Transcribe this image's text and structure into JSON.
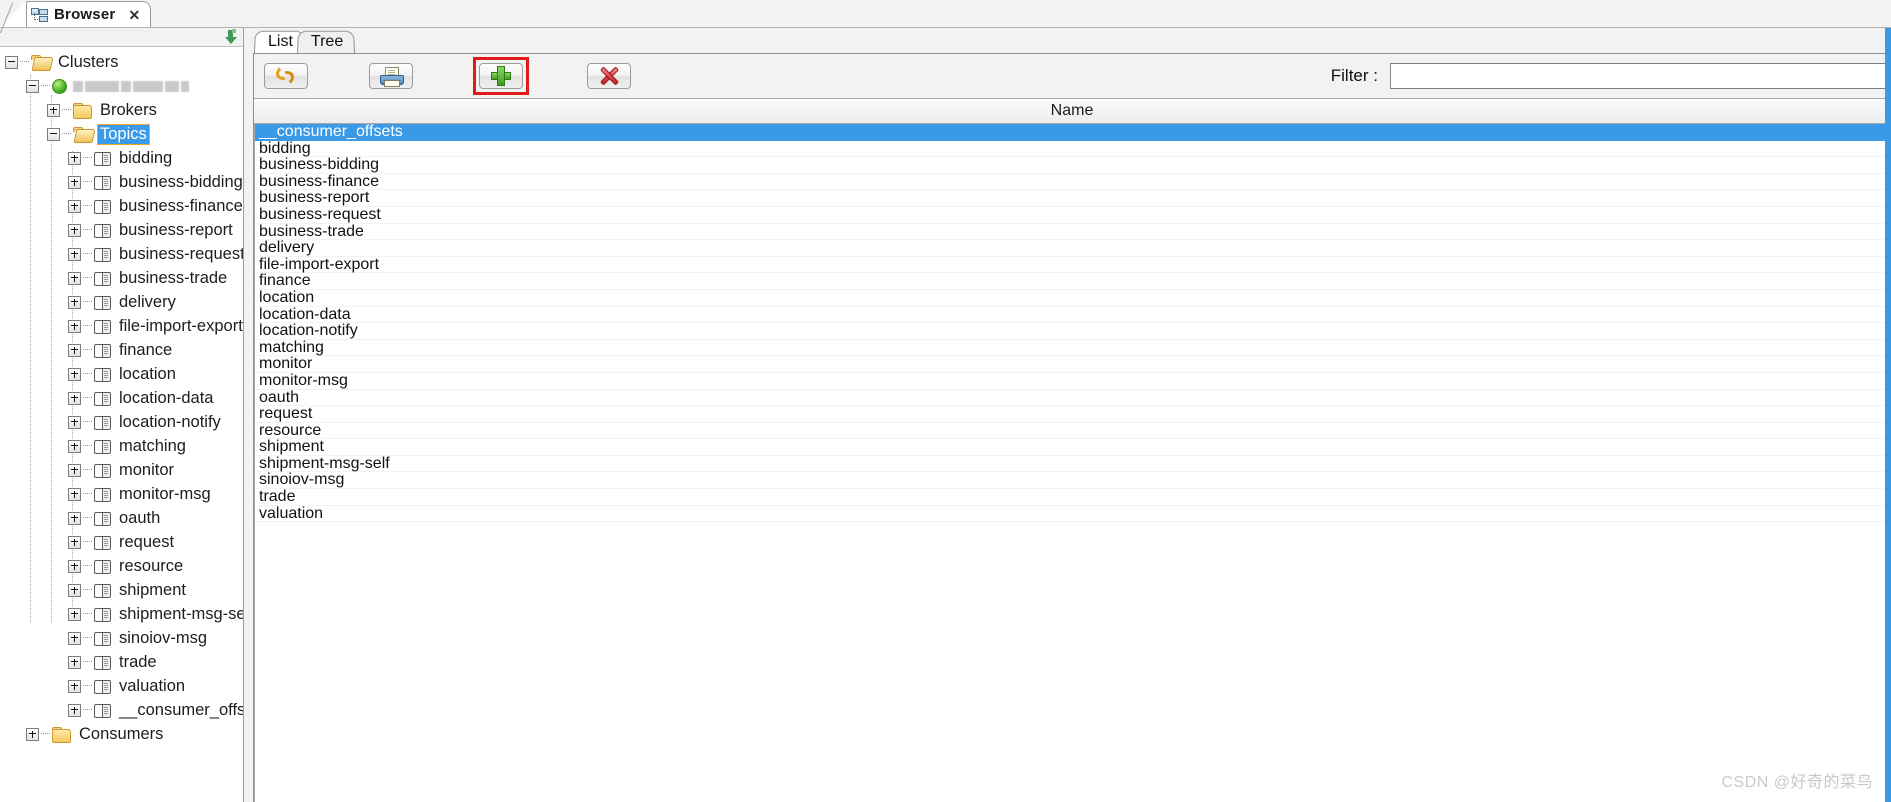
{
  "window": {
    "tab_title": "Browser",
    "tab_close": "✕",
    "browser_icon": "browser-tree-icon"
  },
  "tree_panel": {
    "collapse_all_icon": "collapse-all-down-arrow-icon",
    "root": {
      "label": "Clusters",
      "cluster": {
        "label_redacted": true,
        "status": "online"
      },
      "children": [
        {
          "label": "Brokers",
          "type": "folder",
          "state": "collapsed"
        },
        {
          "label": "Topics",
          "type": "folder",
          "state": "expanded",
          "selected": true
        },
        {
          "label": "Consumers",
          "type": "folder",
          "state": "collapsed"
        }
      ]
    },
    "topics": [
      "bidding",
      "business-bidding",
      "business-finance",
      "business-report",
      "business-request",
      "business-trade",
      "delivery",
      "file-import-export",
      "finance",
      "location",
      "location-data",
      "location-notify",
      "matching",
      "monitor",
      "monitor-msg",
      "oauth",
      "request",
      "resource",
      "shipment",
      "shipment-msg-self",
      "sinoiov-msg",
      "trade",
      "valuation",
      "__consumer_offsets"
    ]
  },
  "content": {
    "tabs": [
      {
        "label": "List",
        "active": true
      },
      {
        "label": "Tree",
        "active": false
      }
    ],
    "toolbar": {
      "buttons": [
        {
          "name": "refresh-button",
          "icon": "refresh-icon",
          "highlighted": false
        },
        {
          "name": "export-button",
          "icon": "printer-icon",
          "highlighted": false
        },
        {
          "name": "add-button",
          "icon": "plus-icon",
          "highlighted": true
        },
        {
          "name": "delete-button",
          "icon": "red-x-icon",
          "highlighted": false
        }
      ],
      "filter_label": "Filter :",
      "filter_value": "",
      "filter_placeholder": ""
    },
    "table": {
      "columns": [
        "Name"
      ],
      "selected_row_index": 0,
      "rows": [
        "__consumer_offsets",
        "bidding",
        "business-bidding",
        "business-finance",
        "business-report",
        "business-request",
        "business-trade",
        "delivery",
        "file-import-export",
        "finance",
        "location",
        "location-data",
        "location-notify",
        "matching",
        "monitor",
        "monitor-msg",
        "oauth",
        "request",
        "resource",
        "shipment",
        "shipment-msg-self",
        "sinoiov-msg",
        "trade",
        "valuation"
      ]
    }
  },
  "watermark": "CSDN @好奇的菜鸟",
  "colors": {
    "selection_blue": "#3a9ae8",
    "highlight_red": "#e01b1b",
    "tab_underline_orange": "#e8912d",
    "panel_gray": "#f2f2f2"
  }
}
